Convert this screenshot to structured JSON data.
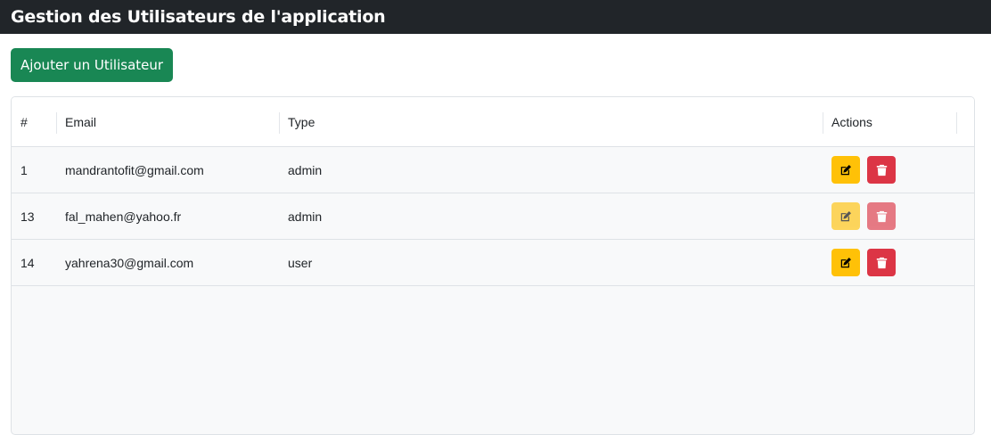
{
  "header": {
    "title": "Gestion des Utilisateurs de l'application",
    "background": "#212529"
  },
  "actions": {
    "add_user_label": "Ajouter un Utilisateur",
    "add_user_color": "#198754"
  },
  "table": {
    "columns": [
      "#",
      "Email",
      "Type",
      "Actions"
    ],
    "rows": [
      {
        "id": "1",
        "email": "mandrantofit@gmail.com",
        "type": "admin",
        "actions_enabled": true
      },
      {
        "id": "13",
        "email": "fal_mahen@yahoo.fr",
        "type": "admin",
        "actions_enabled": false
      },
      {
        "id": "14",
        "email": "yahrena30@gmail.com",
        "type": "user",
        "actions_enabled": true
      }
    ],
    "row_actions": {
      "edit_icon": "edit-icon",
      "edit_color": "#ffc107",
      "delete_icon": "trash-icon",
      "delete_color": "#dc3545"
    }
  }
}
